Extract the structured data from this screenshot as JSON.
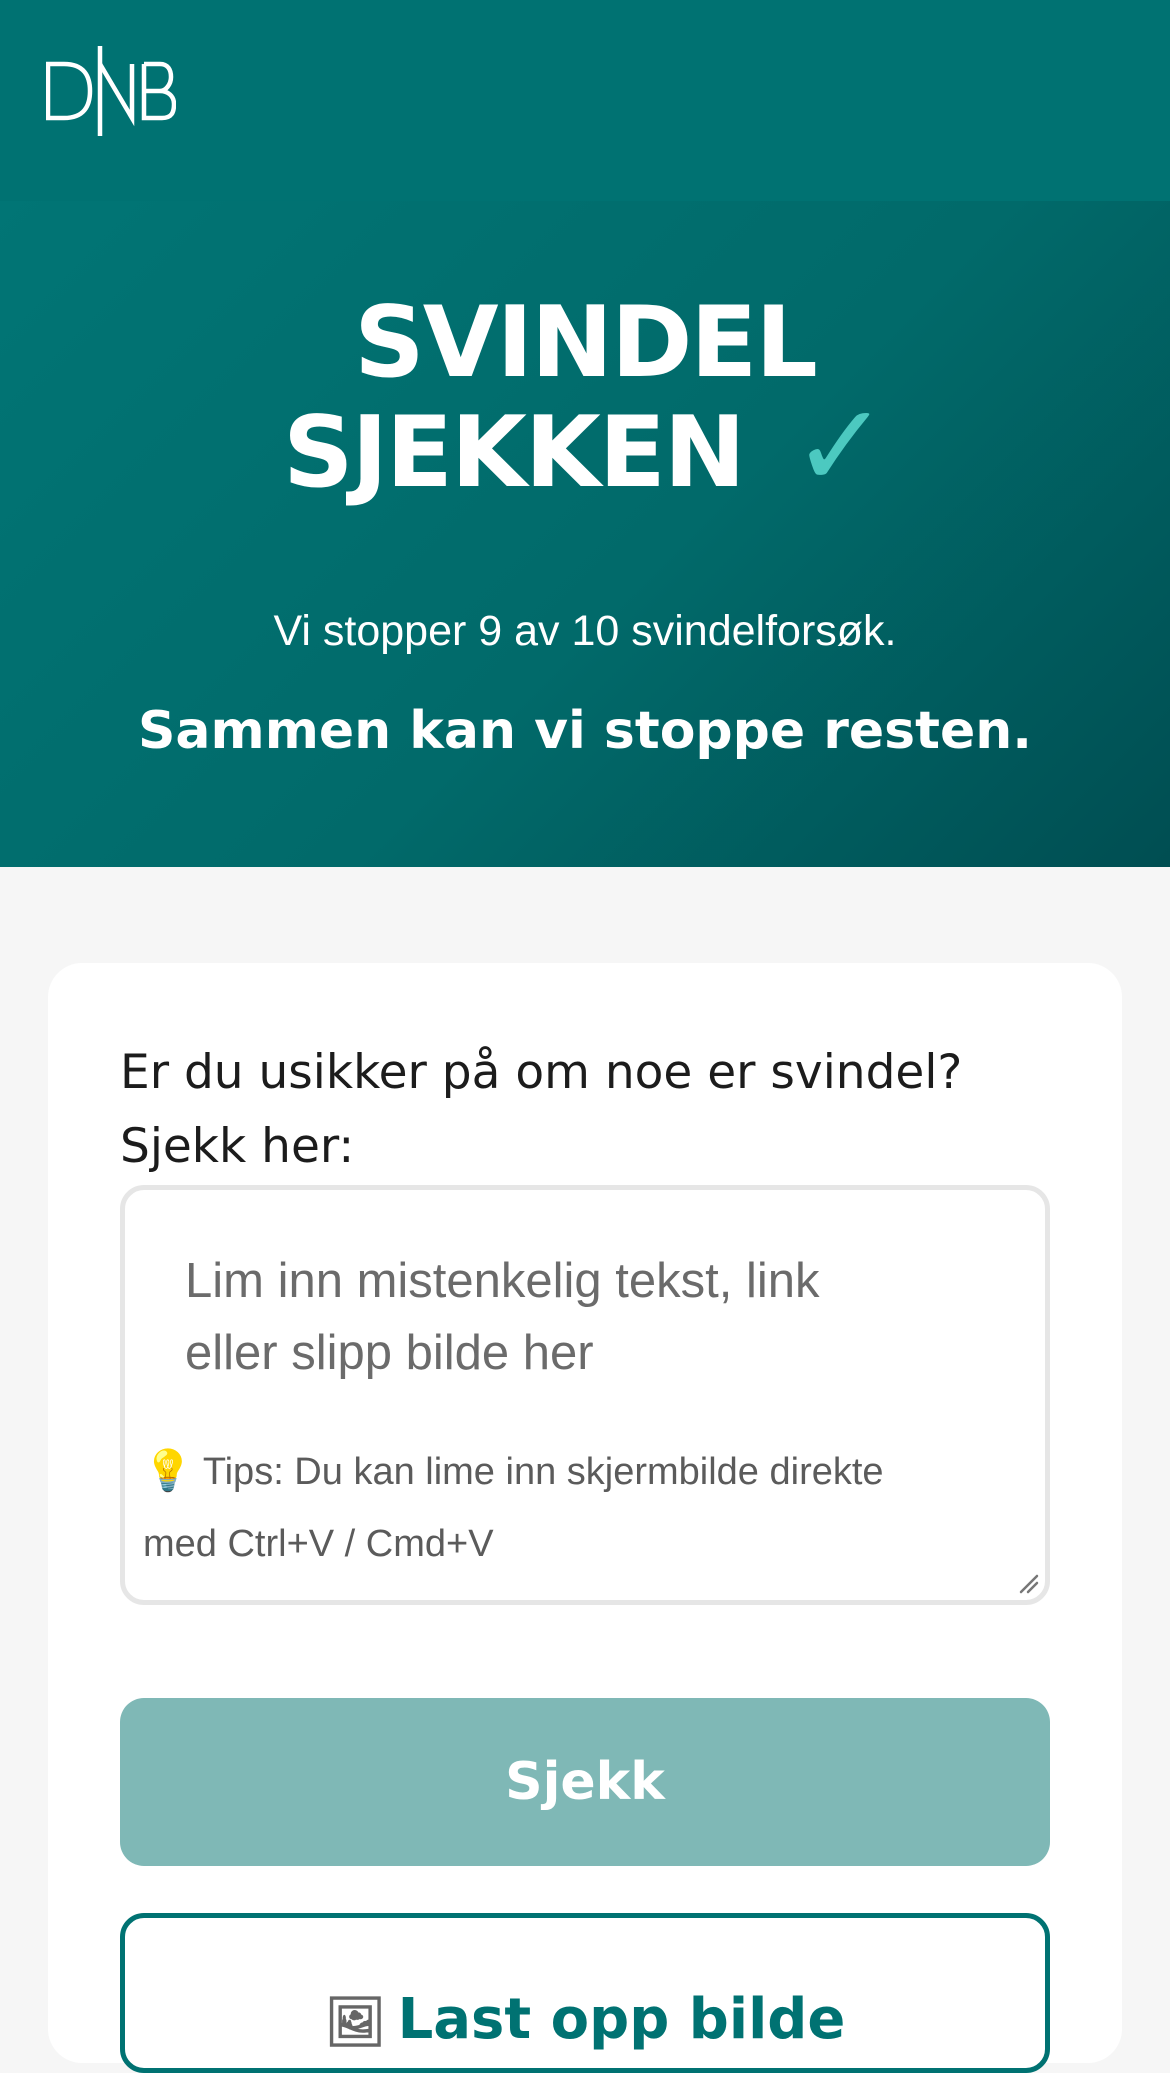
{
  "brand": {
    "logo_text": "DNB",
    "primary_color": "#007272",
    "accent_color": "#4cc9c0"
  },
  "hero": {
    "title_line1": "SVINDEL",
    "title_line2": "SJEKKEN",
    "check_glyph": "✓",
    "subtitle": "Vi stopper 9 av 10 svindelforsøk.",
    "subtitle_strong": "Sammen kan vi stoppe resten."
  },
  "card": {
    "question_line1": "Er du usikker på om noe er svindel?",
    "question_line2": "Sjekk her:",
    "input": {
      "value": "",
      "placeholder_line1": "Lim inn mistenkelig tekst, link",
      "placeholder_line2": "eller slipp bilde her",
      "tip_icon": "lightbulb-icon",
      "tip_line1": "Tips: Du kan lime inn skjermbilde direkte",
      "tip_line2": "med Ctrl+V / Cmd+V"
    },
    "check_button_label": "Sjekk",
    "check_button_color": "#7fb8b6",
    "upload_button_label": "Last opp bilde",
    "upload_button_icon": "image-icon"
  }
}
